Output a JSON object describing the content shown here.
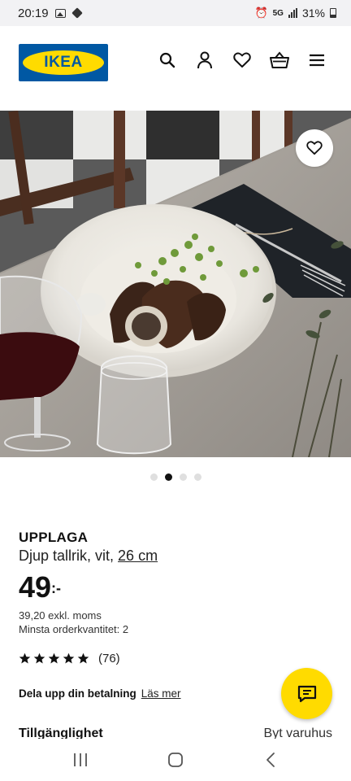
{
  "status_bar": {
    "time": "20:19",
    "battery": "31%",
    "network": "5G"
  },
  "header": {
    "logo_text": "IKEA",
    "icons": [
      "search-icon",
      "profile-icon",
      "heart-icon",
      "basket-icon",
      "menu-icon"
    ]
  },
  "carousel": {
    "dot_count": 4,
    "active_index": 1
  },
  "product": {
    "name": "UPPLAGA",
    "description": "Djup tallrik, vit,",
    "size": "26 cm",
    "price_main": "49",
    "price_suffix": ":-",
    "price_excl_vat": "39,20 exkl. moms",
    "min_order": "Minsta orderkvantitet: 2",
    "rating": 5,
    "review_count": "(76)"
  },
  "payment": {
    "title": "Dela upp din betalning",
    "link": "Läs mer"
  },
  "availability": {
    "title": "Tillgänglighet",
    "change_store": "Byt varuhus"
  },
  "colors": {
    "brand_blue": "#0058a3",
    "brand_yellow": "#ffdb00"
  }
}
